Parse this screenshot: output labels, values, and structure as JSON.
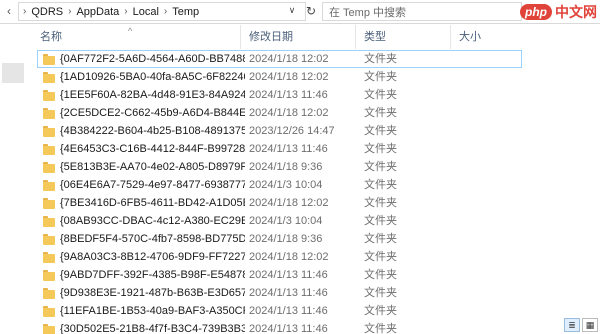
{
  "addressbar": {
    "crumbs": [
      "QDRS",
      "AppData",
      "Local",
      "Temp"
    ]
  },
  "search": {
    "placeholder": "在 Temp 中搜索"
  },
  "watermark": {
    "badge": "php",
    "text": "中文网"
  },
  "columns": {
    "name": "名称",
    "date": "修改日期",
    "type": "类型",
    "size": "大小"
  },
  "files": [
    {
      "name": "{0AF772F2-5A6D-4564-A60D-BB7488...",
      "date": "2024/1/18 12:02",
      "type": "文件夹"
    },
    {
      "name": "{1AD10926-5BA0-40fa-8A5C-6F82240...",
      "date": "2024/1/18 12:02",
      "type": "文件夹"
    },
    {
      "name": "{1EE5F60A-82BA-4d48-91E3-84A924F...",
      "date": "2024/1/13 11:46",
      "type": "文件夹"
    },
    {
      "name": "{2CE5DCE2-C662-45b9-A6D4-B844E6...",
      "date": "2024/1/18 12:02",
      "type": "文件夹"
    },
    {
      "name": "{4B384222-B604-4b25-B108-4891375...",
      "date": "2023/12/26 14:47",
      "type": "文件夹"
    },
    {
      "name": "{4E6453C3-C16B-4412-844F-B997285...",
      "date": "2024/1/13 11:46",
      "type": "文件夹"
    },
    {
      "name": "{5E813B3E-AA70-4e02-A805-D8979F...",
      "date": "2024/1/18 9:36",
      "type": "文件夹"
    },
    {
      "name": "{06E4E6A7-7529-4e97-8477-6938777...",
      "date": "2024/1/3 10:04",
      "type": "文件夹"
    },
    {
      "name": "{7BE3416D-6FB5-4611-BD42-A1D05E...",
      "date": "2024/1/18 12:02",
      "type": "文件夹"
    },
    {
      "name": "{08AB93CC-DBAC-4c12-A380-EC29EC...",
      "date": "2024/1/3 10:04",
      "type": "文件夹"
    },
    {
      "name": "{8BEDF5F4-570C-4fb7-8598-BD775D...",
      "date": "2024/1/18 9:36",
      "type": "文件夹"
    },
    {
      "name": "{9A8A03C3-8B12-4706-9DF9-FF72270...",
      "date": "2024/1/18 12:02",
      "type": "文件夹"
    },
    {
      "name": "{9ABD7DFF-392F-4385-B98F-E54878...",
      "date": "2024/1/13 11:46",
      "type": "文件夹"
    },
    {
      "name": "{9D938E3E-1921-487b-B63B-E3D657...",
      "date": "2024/1/13 11:46",
      "type": "文件夹"
    },
    {
      "name": "{11EFA1BE-1B53-40a9-BAF3-A350CF...",
      "date": "2024/1/13 11:46",
      "type": "文件夹"
    },
    {
      "name": "{30D502E5-21B8-4f7f-B3C4-739B3B3...",
      "date": "2024/1/13 11:46",
      "type": "文件夹"
    }
  ],
  "colors": {
    "selection_border": "#99d1ff",
    "folder": "#f5c85a",
    "header_text": "#4c607a"
  },
  "icons": {
    "folder": "folder-icon",
    "refresh": "refresh-icon",
    "dropdown": "chevron-down-icon",
    "sort": "sort-up-icon"
  }
}
